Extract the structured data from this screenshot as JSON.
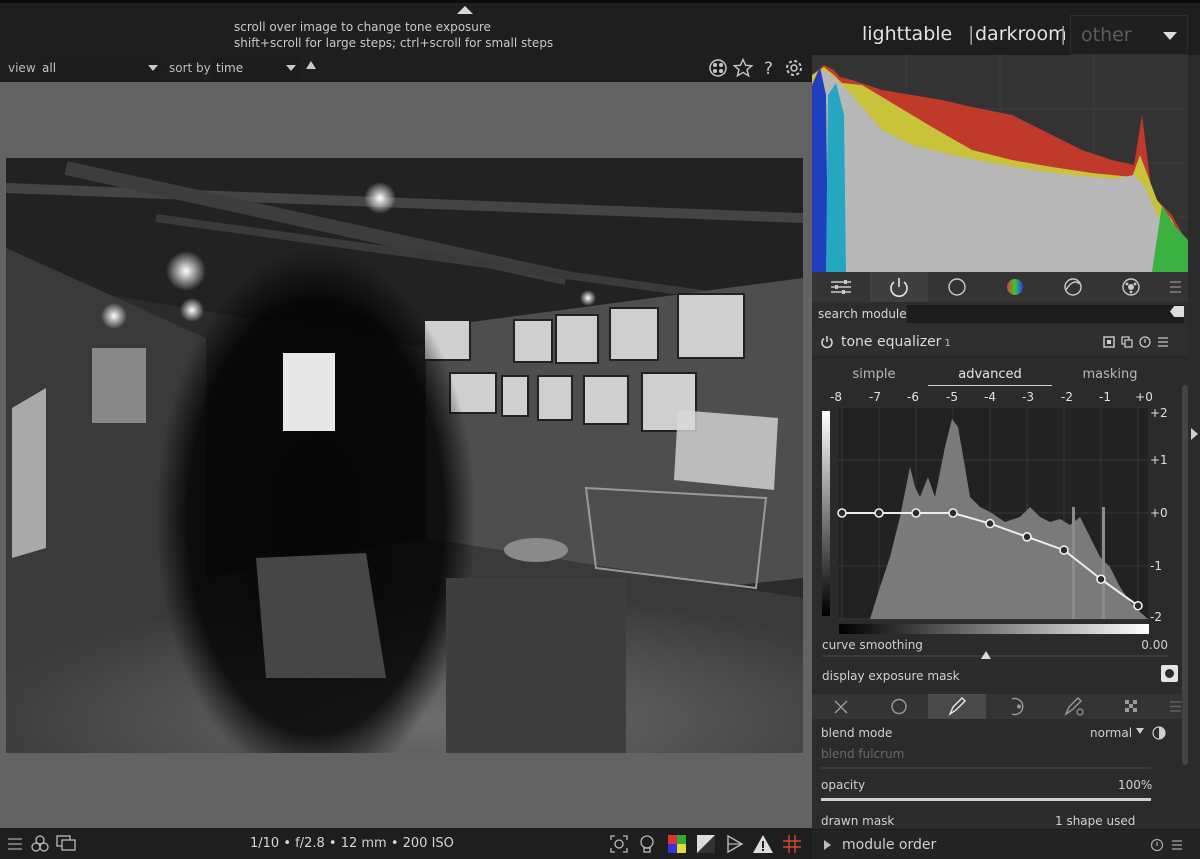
{
  "header": {
    "hint_line1": "scroll over image to change tone exposure",
    "hint_line2": "shift+scroll for large steps; ctrl+scroll for small steps",
    "views": {
      "lighttable": "lighttable",
      "darkroom": "darkroom",
      "other": "other",
      "separator": "|"
    }
  },
  "filterbar": {
    "view_label": "view",
    "view_value": "all",
    "sort_label": "sort by",
    "sort_value": "time",
    "icons": [
      "shapes-icon",
      "star-icon",
      "help-icon",
      "gear-icon"
    ]
  },
  "modulegroups": {
    "icons": [
      "sliders-icon",
      "power-icon",
      "circle-icon",
      "color-wheel-icon",
      "correct-icon",
      "effect-icon",
      "menu-icon"
    ],
    "active": "power-icon"
  },
  "search": {
    "label": "search module",
    "placeholder": ""
  },
  "tone_equalizer": {
    "title": "tone equalizer",
    "instance": "1",
    "tabs": [
      "simple",
      "advanced",
      "masking"
    ],
    "active_tab": "advanced",
    "ev_labels": [
      "-8",
      "-7",
      "-6",
      "-5",
      "-4",
      "-3",
      "-2",
      "-1",
      "+0"
    ],
    "y_labels": [
      "+2",
      "+1",
      "+0",
      "-1",
      "-2"
    ],
    "curve_nodes_ev": [
      0,
      0,
      0,
      0,
      -0.2,
      -0.45,
      -0.7,
      -1.25,
      -1.75
    ],
    "curve_smoothing_label": "curve smoothing",
    "curve_smoothing_value": "0.00",
    "display_mask_label": "display exposure mask"
  },
  "blending": {
    "tabs": [
      "off-icon",
      "uniform-icon",
      "drawn-icon",
      "parametric-icon",
      "drawn-parametric-icon",
      "raster-icon",
      "menu-icon"
    ],
    "active_tab": "drawn-icon",
    "blend_mode_label": "blend mode",
    "blend_mode_value": "normal",
    "blend_fulcrum_label": "blend fulcrum",
    "opacity_label": "opacity",
    "opacity_value": "100%",
    "drawn_mask_label": "drawn mask",
    "drawn_mask_value": "1 shape used"
  },
  "module_order": {
    "label": "module order"
  },
  "bottombar": {
    "exif": "1/10 • f/2.8 • 12 mm • 200 ISO"
  },
  "colors": {
    "accent": "#dcdcdc",
    "histogram_red": "#c0392b",
    "histogram_blue": "#1f3fbf",
    "histogram_yellow": "#c9c33a"
  }
}
